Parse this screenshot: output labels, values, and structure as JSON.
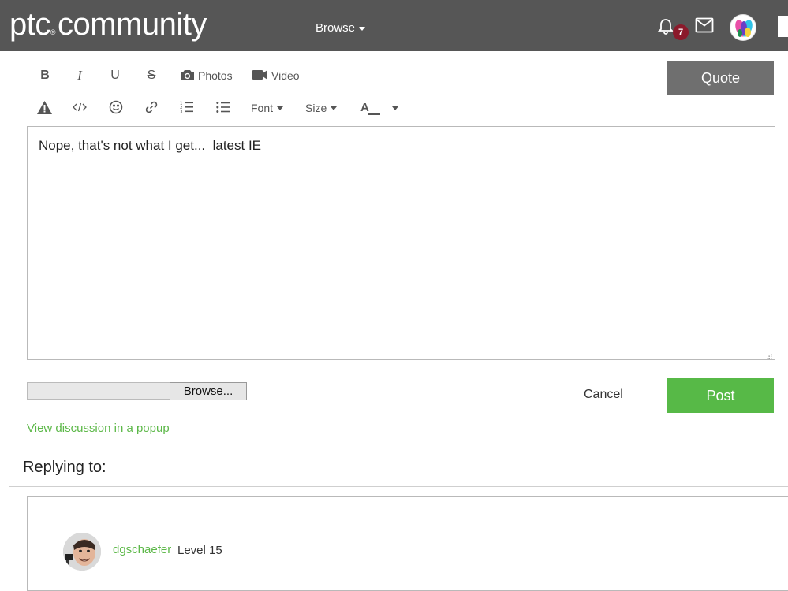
{
  "header": {
    "logo_text": "ptc",
    "logo_reg": "®",
    "logo_suffix": "community",
    "browse_label": "Browse",
    "notification_count": "7"
  },
  "toolbar": {
    "bold": "B",
    "italic": "I",
    "underline": "U",
    "strike": "S",
    "photos_label": "Photos",
    "video_label": "Video",
    "font_label": "Font",
    "size_label": "Size",
    "color_label": "A",
    "quote_label": "Quote"
  },
  "editor": {
    "content": "Nope, that's not what I get...  latest IE"
  },
  "attachment": {
    "browse_label": "Browse..."
  },
  "actions": {
    "cancel_label": "Cancel",
    "post_label": "Post"
  },
  "links": {
    "popup_label": "View discussion in a popup"
  },
  "reply": {
    "heading": "Replying to:",
    "username": "dgschaefer",
    "level": "Level 15"
  },
  "colors": {
    "header_bg": "#565656",
    "accent_green": "#57b947",
    "link_green": "#5cb848",
    "badge_red": "#8b1a2b",
    "quote_bg": "#6f6f6f"
  },
  "icons": [
    "bell-icon",
    "mail-icon",
    "camera-icon",
    "video-camera-icon",
    "warning-icon",
    "code-icon",
    "smiley-icon",
    "link-icon",
    "ordered-list-icon",
    "unordered-list-icon",
    "resize-grip-icon"
  ]
}
